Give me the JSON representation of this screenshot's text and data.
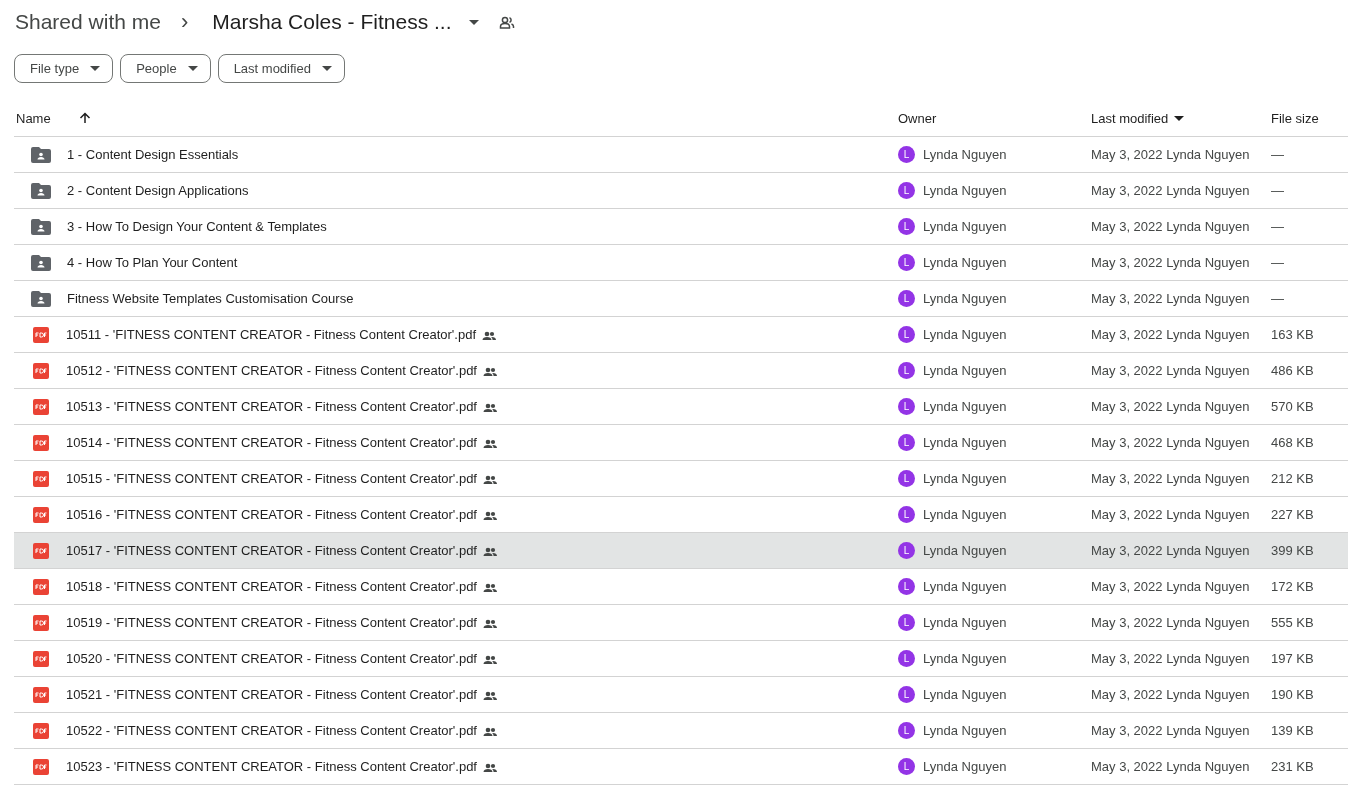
{
  "breadcrumb": {
    "parent": "Shared with me",
    "separator": "›",
    "current": "Marsha Coles - Fitness ...",
    "shared": true
  },
  "filters": [
    "File type",
    "People",
    "Last modified"
  ],
  "table": {
    "columns": [
      {
        "label": "Name",
        "sorted_ascending": true,
        "sorted_descending": false
      },
      {
        "label": "Owner",
        "sorted_ascending": false,
        "sorted_descending": false
      },
      {
        "label": "Last modified",
        "sorted_ascending": false,
        "sorted_descending": true
      },
      {
        "label": "File size",
        "sorted_ascending": false,
        "sorted_descending": false
      }
    ],
    "rows": [
      {
        "kind": "folder",
        "name": "1 - Content Design Essentials",
        "shared": false,
        "hovered": false,
        "owner_initial": "L",
        "owner": "Lynda Nguyen",
        "modified": "May 3, 2022 Lynda Nguyen",
        "size": "—"
      },
      {
        "kind": "folder",
        "name": "2 - Content Design Applications",
        "shared": false,
        "hovered": false,
        "owner_initial": "L",
        "owner": "Lynda Nguyen",
        "modified": "May 3, 2022 Lynda Nguyen",
        "size": "—"
      },
      {
        "kind": "folder",
        "name": "3 - How To Design Your Content & Templates",
        "shared": false,
        "hovered": false,
        "owner_initial": "L",
        "owner": "Lynda Nguyen",
        "modified": "May 3, 2022 Lynda Nguyen",
        "size": "—"
      },
      {
        "kind": "folder",
        "name": "4 - How To Plan Your Content",
        "shared": false,
        "hovered": false,
        "owner_initial": "L",
        "owner": "Lynda Nguyen",
        "modified": "May 3, 2022 Lynda Nguyen",
        "size": "—"
      },
      {
        "kind": "folder",
        "name": "Fitness Website Templates Customisation Course",
        "shared": false,
        "hovered": false,
        "owner_initial": "L",
        "owner": "Lynda Nguyen",
        "modified": "May 3, 2022 Lynda Nguyen",
        "size": "—"
      },
      {
        "kind": "pdf",
        "name": "10511 - 'FITNESS CONTENT CREATOR - Fitness Content Creator'.pdf",
        "shared": true,
        "hovered": false,
        "owner_initial": "L",
        "owner": "Lynda Nguyen",
        "modified": "May 3, 2022 Lynda Nguyen",
        "size": "163 KB"
      },
      {
        "kind": "pdf",
        "name": "10512 - 'FITNESS CONTENT CREATOR - Fitness Content Creator'.pdf",
        "shared": true,
        "hovered": false,
        "owner_initial": "L",
        "owner": "Lynda Nguyen",
        "modified": "May 3, 2022 Lynda Nguyen",
        "size": "486 KB"
      },
      {
        "kind": "pdf",
        "name": "10513 - 'FITNESS CONTENT CREATOR - Fitness Content Creator'.pdf",
        "shared": true,
        "hovered": false,
        "owner_initial": "L",
        "owner": "Lynda Nguyen",
        "modified": "May 3, 2022 Lynda Nguyen",
        "size": "570 KB"
      },
      {
        "kind": "pdf",
        "name": "10514 - 'FITNESS CONTENT CREATOR - Fitness Content Creator'.pdf",
        "shared": true,
        "hovered": false,
        "owner_initial": "L",
        "owner": "Lynda Nguyen",
        "modified": "May 3, 2022 Lynda Nguyen",
        "size": "468 KB"
      },
      {
        "kind": "pdf",
        "name": "10515 - 'FITNESS CONTENT CREATOR - Fitness Content Creator'.pdf",
        "shared": true,
        "hovered": false,
        "owner_initial": "L",
        "owner": "Lynda Nguyen",
        "modified": "May 3, 2022 Lynda Nguyen",
        "size": "212 KB"
      },
      {
        "kind": "pdf",
        "name": "10516 - 'FITNESS CONTENT CREATOR - Fitness Content Creator'.pdf",
        "shared": true,
        "hovered": false,
        "owner_initial": "L",
        "owner": "Lynda Nguyen",
        "modified": "May 3, 2022 Lynda Nguyen",
        "size": "227 KB"
      },
      {
        "kind": "pdf",
        "name": "10517 - 'FITNESS CONTENT CREATOR - Fitness Content Creator'.pdf",
        "shared": true,
        "hovered": true,
        "owner_initial": "L",
        "owner": "Lynda Nguyen",
        "modified": "May 3, 2022 Lynda Nguyen",
        "size": "399 KB"
      },
      {
        "kind": "pdf",
        "name": "10518 - 'FITNESS CONTENT CREATOR - Fitness Content Creator'.pdf",
        "shared": true,
        "hovered": false,
        "owner_initial": "L",
        "owner": "Lynda Nguyen",
        "modified": "May 3, 2022 Lynda Nguyen",
        "size": "172 KB"
      },
      {
        "kind": "pdf",
        "name": "10519 - 'FITNESS CONTENT CREATOR - Fitness Content Creator'.pdf",
        "shared": true,
        "hovered": false,
        "owner_initial": "L",
        "owner": "Lynda Nguyen",
        "modified": "May 3, 2022 Lynda Nguyen",
        "size": "555 KB"
      },
      {
        "kind": "pdf",
        "name": "10520 - 'FITNESS CONTENT CREATOR - Fitness Content Creator'.pdf",
        "shared": true,
        "hovered": false,
        "owner_initial": "L",
        "owner": "Lynda Nguyen",
        "modified": "May 3, 2022 Lynda Nguyen",
        "size": "197 KB"
      },
      {
        "kind": "pdf",
        "name": "10521 - 'FITNESS CONTENT CREATOR - Fitness Content Creator'.pdf",
        "shared": true,
        "hovered": false,
        "owner_initial": "L",
        "owner": "Lynda Nguyen",
        "modified": "May 3, 2022 Lynda Nguyen",
        "size": "190 KB"
      },
      {
        "kind": "pdf",
        "name": "10522 - 'FITNESS CONTENT CREATOR - Fitness Content Creator'.pdf",
        "shared": true,
        "hovered": false,
        "owner_initial": "L",
        "owner": "Lynda Nguyen",
        "modified": "May 3, 2022 Lynda Nguyen",
        "size": "139 KB"
      },
      {
        "kind": "pdf",
        "name": "10523 - 'FITNESS CONTENT CREATOR - Fitness Content Creator'.pdf",
        "shared": true,
        "hovered": false,
        "owner_initial": "L",
        "owner": "Lynda Nguyen",
        "modified": "May 3, 2022 Lynda Nguyen",
        "size": "231 KB"
      }
    ]
  }
}
